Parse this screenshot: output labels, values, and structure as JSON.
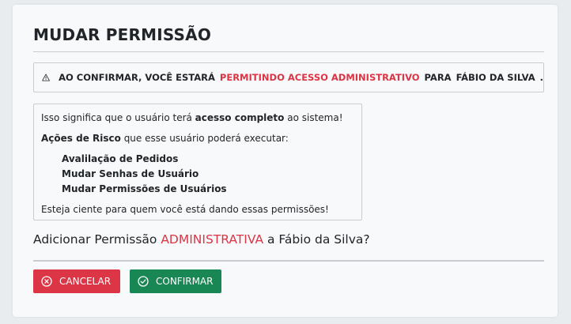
{
  "modal": {
    "title": "MUDAR PERMISSÃO",
    "warning": {
      "icon": "warning-triangle-icon",
      "prefix": "AO CONFIRMAR, VOCÊ ESTARÁ",
      "highlight": "PERMITINDO ACESSO ADMINISTRATIVO",
      "middle": "PARA",
      "user": "FÁBIO DA SILVA",
      "end": "."
    },
    "info": {
      "line1_pre": "Isso significa que o usuário terá ",
      "line1_bold": "acesso completo",
      "line1_post": " ao sistema!",
      "line2_bold": "Ações de Risco",
      "line2_post": " que esse usuário poderá executar:",
      "risks": [
        "Avalilação de Pedidos",
        "Mudar Senhas de Usuário",
        "Mudar Permissões de Usuários"
      ],
      "footer": "Esteja ciente para quem você está dando essas permissões!"
    },
    "question": {
      "pre": "Adicionar Permissão ",
      "highlight": "ADMINISTRATIVA",
      "post": " a Fábio da Silva?"
    },
    "buttons": {
      "cancel": "CANCELAR",
      "confirm": "CONFIRMAR"
    },
    "colors": {
      "danger": "#dc3545",
      "success": "#198754"
    }
  }
}
